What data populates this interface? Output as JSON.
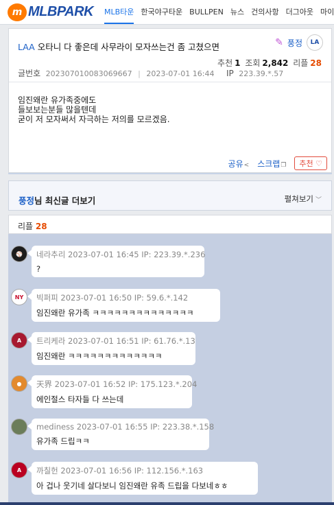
{
  "nav": {
    "logo": "MLBPARK",
    "items": [
      "MLB타운",
      "한국야구타운",
      "BULLPEN",
      "뉴스",
      "건의사항",
      "더그아웃",
      "마이"
    ]
  },
  "article": {
    "category": "LAA",
    "title": "오타니 다 좋은데 사무라이 모자쓰는건 좀 고쳤으면",
    "author": "풍정",
    "team_logo": "LA",
    "stats": {
      "reco_label": "추천",
      "reco_value": "1",
      "views_label": "조회",
      "views_value": "2,842",
      "replies_label": "리플",
      "replies_value": "28"
    },
    "number_label": "글번호",
    "number": "202307010083069667",
    "datetime": "2023-07-01 16:44",
    "ip_label": "IP",
    "ip": "223.39.*.57",
    "body": [
      "임진왜란 유가족중에도",
      "들보보는분들 많을텐데",
      "굳이 저 모자써서 자극하는 저의를 모르겠음."
    ],
    "share_label": "공유",
    "scrap_label": "스크랩",
    "recommend_label": "추천 ♡"
  },
  "more_bar": {
    "name": "풍정",
    "suffix": "님 최신글 더보기",
    "toggle": "펼쳐보기"
  },
  "replies": {
    "label": "리플",
    "count": "28"
  },
  "comments": [
    {
      "user": "네라추리",
      "datetime": "2023-07-01 16:45",
      "ip": "IP: 223.39.*.236",
      "text": "?",
      "avatar_color": "#1c1c1c"
    },
    {
      "user": "빅퍼피",
      "datetime": "2023-07-01 16:50",
      "ip": "IP: 59.6.*.142",
      "text": "임진왜란 유가족 ㅋㅋㅋㅋㅋㅋㅋㅋㅋㅋㅋㅋㅋㅋ",
      "avatar_color": "#c8102e"
    },
    {
      "user": "트리케라",
      "datetime": "2023-07-01 16:51",
      "ip": "IP: 61.76.*.13",
      "text": "임진왜란 ㅋㅋㅋㅋㅋㅋㅋㅋㅋㅋㅋㅋㅋ",
      "avatar_color": "#a71930"
    },
    {
      "user": "天界",
      "datetime": "2023-07-01 16:52",
      "ip": "IP: 175.123.*.204",
      "text": "에인절스 타자들 다 쓰는데",
      "avatar_color": "#e38a2e"
    },
    {
      "user": "mediness",
      "datetime": "2023-07-01 16:55",
      "ip": "IP: 223.38.*.158",
      "text": "유가족 드립ㅋㅋ",
      "avatar_color": "#6b7d5a"
    },
    {
      "user": "까칠헌",
      "datetime": "2023-07-01 16:56",
      "ip": "IP: 112.156.*.163",
      "text": "아 겁나 웃기네 살다보니 임진왜란 유족 드립을 다보네ㅎㅎ",
      "avatar_color": "#ba0021"
    }
  ]
}
